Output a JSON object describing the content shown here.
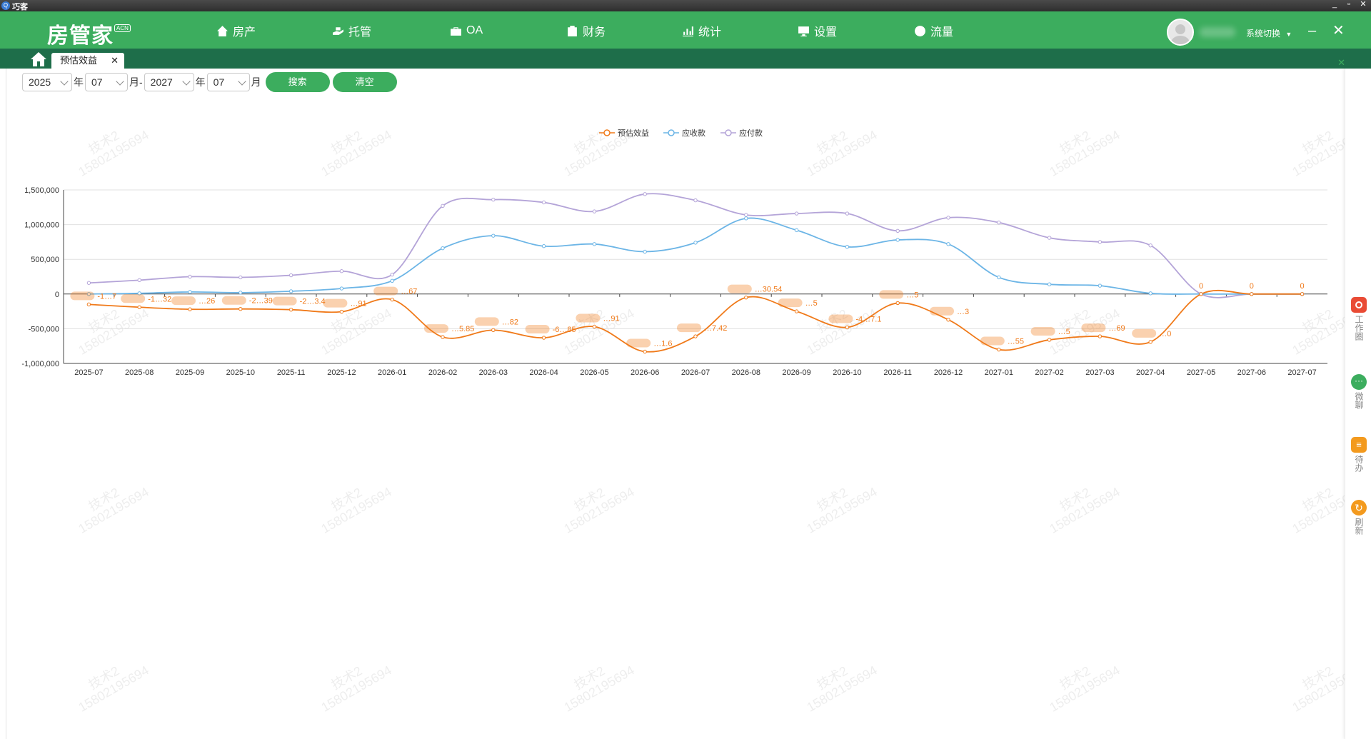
{
  "window": {
    "title": "巧客",
    "buttons": [
      "_",
      "▫",
      "✕"
    ]
  },
  "header": {
    "logo": "房管家",
    "logo_badge": "ACN",
    "nav": [
      {
        "label": "房产",
        "icon": "home-icon"
      },
      {
        "label": "托管",
        "icon": "hand-icon"
      },
      {
        "label": "OA",
        "icon": "briefcase-icon"
      },
      {
        "label": "财务",
        "icon": "wallet-icon"
      },
      {
        "label": "统计",
        "icon": "bar-chart-icon"
      },
      {
        "label": "设置",
        "icon": "monitor-icon"
      },
      {
        "label": "流量",
        "icon": "traffic-icon"
      }
    ],
    "switch_system": "系统切换",
    "minimize": "–",
    "close": "✕"
  },
  "tabs": [
    {
      "label": "预估效益",
      "close": "✕"
    }
  ],
  "tabbar_close": "✕",
  "filter": {
    "start_year": "2025",
    "start_month": "07",
    "end_year": "2027",
    "end_month": "07",
    "year_unit": "年",
    "month_unit_dash": "月-",
    "month_unit": "月",
    "search_button": "搜索",
    "clear_button": "清空"
  },
  "watermark": {
    "line1": "技术2",
    "line2": "15802195694"
  },
  "sidebar": [
    {
      "label": "工作圈",
      "icon": "camera-icon",
      "color": "#e94b35"
    },
    {
      "label": "微聊",
      "icon": "chat-icon",
      "color": "#3cad5e"
    },
    {
      "label": "待办",
      "icon": "todo-icon",
      "color": "#f39a1e"
    },
    {
      "label": "刷新",
      "icon": "refresh-icon",
      "color": "#f39a1e"
    }
  ],
  "chart_data": {
    "type": "line",
    "smooth": true,
    "legend": [
      "预估效益",
      "应收款",
      "应付款"
    ],
    "legend_position": "top-center",
    "categories": [
      "2025-07",
      "2025-08",
      "2025-09",
      "2025-10",
      "2025-11",
      "2025-12",
      "2026-01",
      "2026-02",
      "2026-03",
      "2026-04",
      "2026-05",
      "2026-06",
      "2026-07",
      "2026-08",
      "2026-09",
      "2026-10",
      "2026-11",
      "2026-12",
      "2027-01",
      "2027-02",
      "2027-03",
      "2027-04",
      "2027-05",
      "2027-06",
      "2027-07"
    ],
    "ylim": [
      -1000000,
      1500000
    ],
    "yticks": [
      "1,500,000",
      "1,000,000",
      "500,000",
      "0",
      "-500,000",
      "-1,000,000"
    ],
    "grid": true,
    "series": [
      {
        "name": "预估效益",
        "color": "#f07a1a",
        "values": [
          -150000,
          -190000,
          -220000,
          -215000,
          -225000,
          -255000,
          -80000,
          -620000,
          -520000,
          -630000,
          -470000,
          -830000,
          -610000,
          -50000,
          -250000,
          -480000,
          -130000,
          -370000,
          -800000,
          -660000,
          -610000,
          -690000,
          0,
          0,
          0
        ],
        "labels": [
          "-1…7",
          "-1…32",
          "…26",
          "-2…39",
          "-2…3.4",
          "…91",
          "…67",
          "…5.85",
          "…82",
          "-6…85",
          "…91",
          "…1.6",
          "…7.42",
          "…30.54",
          "…5",
          "-4…7.1",
          "…5",
          "…3",
          "…55",
          "…5",
          "…69",
          "…0",
          "0",
          "0",
          "0"
        ]
      },
      {
        "name": "应收款",
        "color": "#6cb5e6",
        "values": [
          0,
          10000,
          30000,
          20000,
          40000,
          80000,
          190000,
          660000,
          840000,
          690000,
          720000,
          610000,
          740000,
          1090000,
          920000,
          680000,
          780000,
          720000,
          240000,
          140000,
          120000,
          10000,
          0,
          0,
          0
        ]
      },
      {
        "name": "应付款",
        "color": "#b4a4d8",
        "values": [
          160000,
          200000,
          250000,
          240000,
          270000,
          330000,
          280000,
          1270000,
          1360000,
          1320000,
          1190000,
          1440000,
          1350000,
          1140000,
          1160000,
          1160000,
          910000,
          1100000,
          1030000,
          810000,
          750000,
          700000,
          0,
          0,
          0
        ]
      }
    ]
  }
}
